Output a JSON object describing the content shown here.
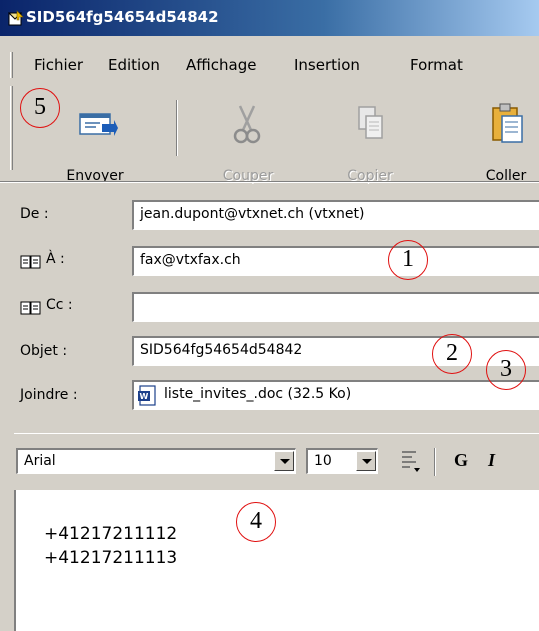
{
  "window": {
    "title": "SID564fg54654d54842"
  },
  "menu": [
    "Fichier",
    "Edition",
    "Affichage",
    "Insertion",
    "Format"
  ],
  "toolbar": {
    "send_label": "Envoyer",
    "cut_label": "Couper",
    "copy_label": "Copier",
    "paste_label": "Coller"
  },
  "fields": {
    "from_label": "De :",
    "from_value": "jean.dupont@vtxnet.ch    (vtxnet)",
    "to_label": "À :",
    "to_value": "fax@vtxfax.ch",
    "cc_label": "Cc :",
    "cc_value": "",
    "subject_label": "Objet :",
    "subject_value": "SID564fg54654d54842",
    "attach_label": "Joindre :",
    "attach_value": "liste_invites_.doc (32.5 Ko)"
  },
  "format_bar": {
    "font": "Arial",
    "size": "10",
    "bold_label": "G",
    "italic_label": "I"
  },
  "body": {
    "lines": [
      "+41217211112",
      "+41217211113"
    ]
  },
  "annotations": [
    "1",
    "2",
    "3",
    "4",
    "5"
  ],
  "colors": {
    "title_bar": "#0a246a",
    "chrome": "#d4d0c8",
    "annotation_circle": "#e01010"
  }
}
